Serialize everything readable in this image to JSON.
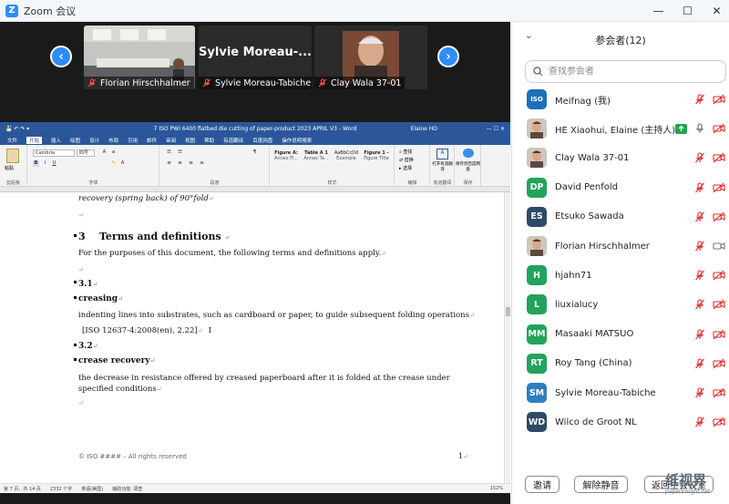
{
  "window": {
    "title": "Zoom 会议",
    "logo_letter": "Z"
  },
  "gallery": {
    "thumbs": [
      {
        "name": "Florian Hirschhalmer"
      },
      {
        "name": "Sylvie Moreau-Tabiche",
        "big_label": "Sylvie Moreau-..."
      },
      {
        "name": "Clay Wala 37-01"
      }
    ],
    "prev_label": "‹",
    "next_label": "›"
  },
  "word": {
    "title": "7 ISO PWI 6400 flatbed die cutting of paper-product 2023 APRIL V3  -  Word",
    "user": "Elaine HO",
    "tabs": [
      "文件",
      "开始",
      "插入",
      "绘图",
      "设计",
      "布局",
      "引用",
      "邮件",
      "审阅",
      "视图",
      "帮助",
      "有道翻译",
      "百度网盘",
      "操作说明搜索"
    ],
    "active_tab_index": 1,
    "ribbon": {
      "paste_label": "粘贴",
      "clipboard_label": "剪贴板",
      "font_name": "Cambria",
      "font_size": "四号",
      "font_label": "字体",
      "paragraph_label": "段落",
      "styles": [
        "Figure A:",
        "Table A 1",
        "AaBbCcDd",
        "Figure 1 -"
      ],
      "style_names": [
        "Annex Fi...",
        "Annex Ta...",
        "Example",
        "Figure Title"
      ],
      "styles_label": "样式",
      "find": "查找",
      "replace": "替换",
      "select": "选择",
      "edit_label": "编辑",
      "translate_label": "打开有道翻译",
      "translate_group": "有道翻译",
      "save_label": "保存到百度网盘",
      "save_group": "保存"
    },
    "document": {
      "line0": "recovery (spring back) of 90°fold",
      "h3_num": "3",
      "h3_title": "Terms and definitions",
      "intro": "For the purposes of this document, the following terms and definitions apply.",
      "t31_num": "3.1",
      "t31_term": "creasing",
      "t31_def": "indenting lines into substrates, such as cardboard or paper, to guide subsequent folding operations",
      "t31_src": "[ISO 12637-4:2008(en), 2.22]",
      "t32_num": "3.2",
      "t32_term": "crease recovery",
      "t32_def": "the decrease in resistance offered by creased paperboard after it is folded at the crease under specified conditions",
      "footer_left": "© ISO #### – All rights reserved",
      "footer_page": "1",
      "pilcrow": "↵"
    },
    "statusbar": {
      "pages": "第 7 页，共 14 页",
      "words": "2332 个字",
      "lang": "英语(美国)",
      "access": "辅助功能: 调查",
      "zoom": "152%"
    }
  },
  "panel": {
    "title": "参会者(12)",
    "search_placeholder": "查找参会者",
    "participants": [
      {
        "name": "Meifnag (我)",
        "avatar": "ISO",
        "color": "#1d6fb8",
        "video": false
      },
      {
        "name": "HE Xiaohui, Elaine (主持人)",
        "avatar": "photo",
        "color": "#b97a5b",
        "video": false,
        "host": true
      },
      {
        "name": "Clay Wala 37-01",
        "avatar": "photo",
        "color": "#8a6a4a",
        "video": false
      },
      {
        "name": "David Penfold",
        "avatar": "DP",
        "color": "#22a35a",
        "video": false
      },
      {
        "name": "Etsuko Sawada",
        "avatar": "ES",
        "color": "#2e4a66",
        "video": false
      },
      {
        "name": "Florian Hirschhalmer",
        "avatar": "photo",
        "color": "#9a6b4b",
        "video": true
      },
      {
        "name": "hjahn71",
        "avatar": "H",
        "color": "#22a35a",
        "video": false
      },
      {
        "name": "liuxialucy",
        "avatar": "L",
        "color": "#22a35a",
        "video": false
      },
      {
        "name": "Masaaki MATSUO",
        "avatar": "MM",
        "color": "#22a35a",
        "video": false
      },
      {
        "name": "Roy Tang (China)",
        "avatar": "RT",
        "color": "#22a35a",
        "video": false
      },
      {
        "name": "Sylvie Moreau-Tabiche",
        "avatar": "SM",
        "color": "#2d7fc1",
        "video": false
      },
      {
        "name": "Wilco de Groot NL",
        "avatar": "WD",
        "color": "#2e4a66",
        "video": false
      }
    ],
    "footer": {
      "invite": "邀请",
      "unmute": "解除静音",
      "more": "返回主会议室"
    }
  },
  "watermark": {
    "text": "纸视界",
    "sub": "paperinsight.net"
  },
  "colors": {
    "zoom_blue": "#2d8cff",
    "word_blue": "#2b579a",
    "muted_red": "#e02828",
    "host_green": "#23a24d"
  }
}
